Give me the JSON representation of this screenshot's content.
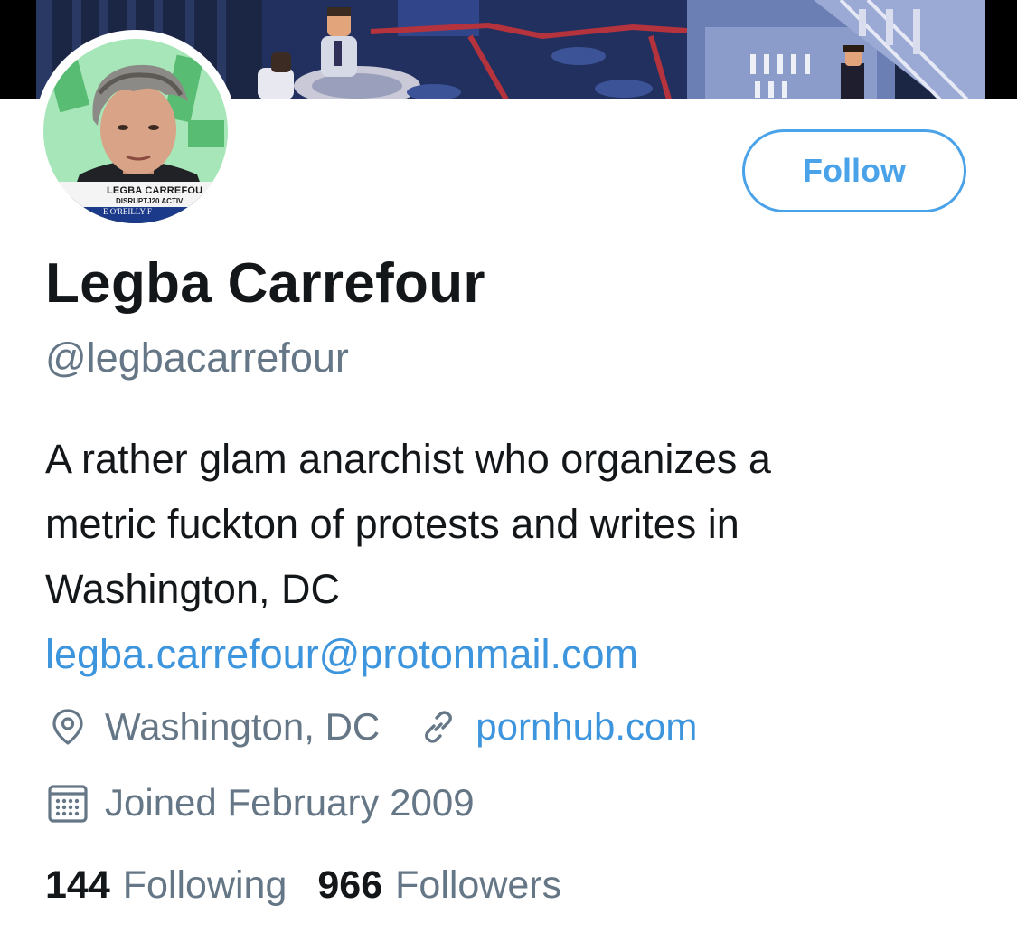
{
  "profile": {
    "display_name": "Legba Carrefour",
    "handle": "@legbacarrefour",
    "bio_lines": [
      "A rather glam anarchist who organizes a",
      "metric fuckton of protests and writes in",
      "Washington, DC"
    ],
    "bio_email": "legba.carrefour@protonmail.com",
    "location": "Washington, DC",
    "website": "pornhub.com",
    "joined": "Joined February 2009",
    "avatar_caption": {
      "line1": "LEGBA CARREFOU",
      "line2": "DISRUPTJ20 ACTIV",
      "line3": "E O'REILLY F"
    }
  },
  "actions": {
    "follow_label": "Follow"
  },
  "stats": {
    "following_count": "144",
    "following_label": "Following",
    "followers_count": "966",
    "followers_label": "Followers"
  },
  "icons": {
    "location": "location-pin-icon",
    "website": "link-icon",
    "joined": "calendar-icon"
  },
  "colors": {
    "accent": "#4aa2e8",
    "link": "#3d95dd",
    "text_primary": "#14171a",
    "text_secondary": "#657786"
  }
}
